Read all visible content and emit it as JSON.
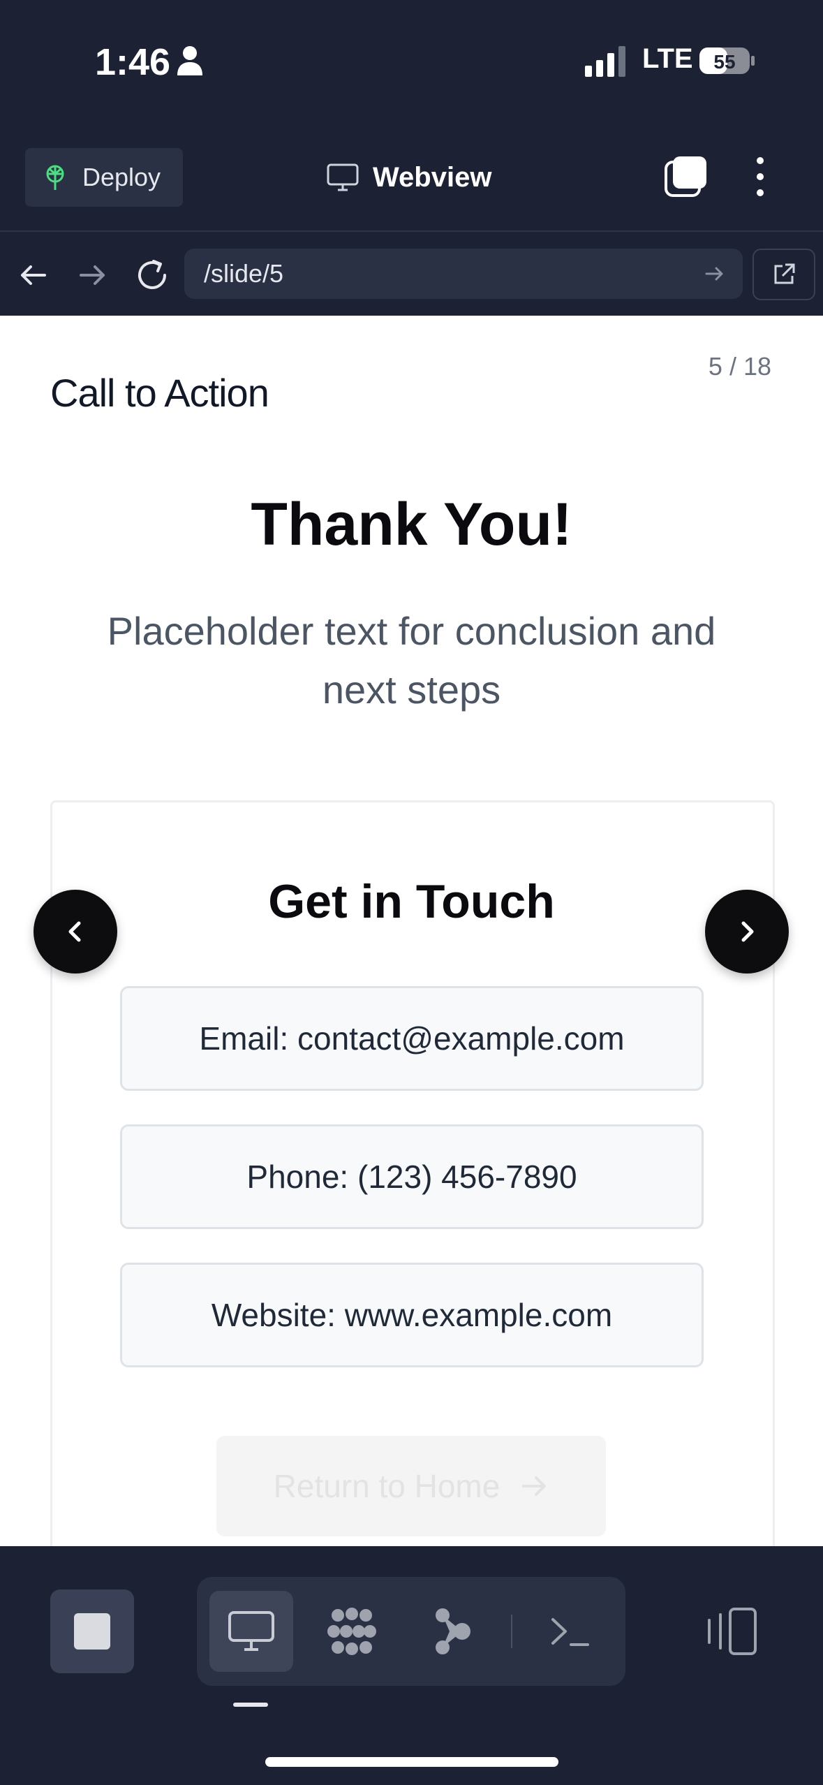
{
  "status": {
    "time": "1:46",
    "network": "LTE",
    "battery": "55"
  },
  "header": {
    "deploy_label": "Deploy",
    "title": "Webview"
  },
  "browser": {
    "url": "/slide/5"
  },
  "slide": {
    "counter": "5 / 18",
    "section_title": "Call to Action",
    "heading": "Thank You!",
    "subtitle": "Placeholder text for conclusion and next steps",
    "card_title": "Get in Touch",
    "contacts": [
      "Email: contact@example.com",
      "Phone: (123) 456-7890",
      "Website: www.example.com"
    ],
    "cta_label": "Return to Home"
  },
  "colors": {
    "app_bg": "#1c2133",
    "surface": "#2b3145",
    "accent_green": "#4ade80"
  }
}
